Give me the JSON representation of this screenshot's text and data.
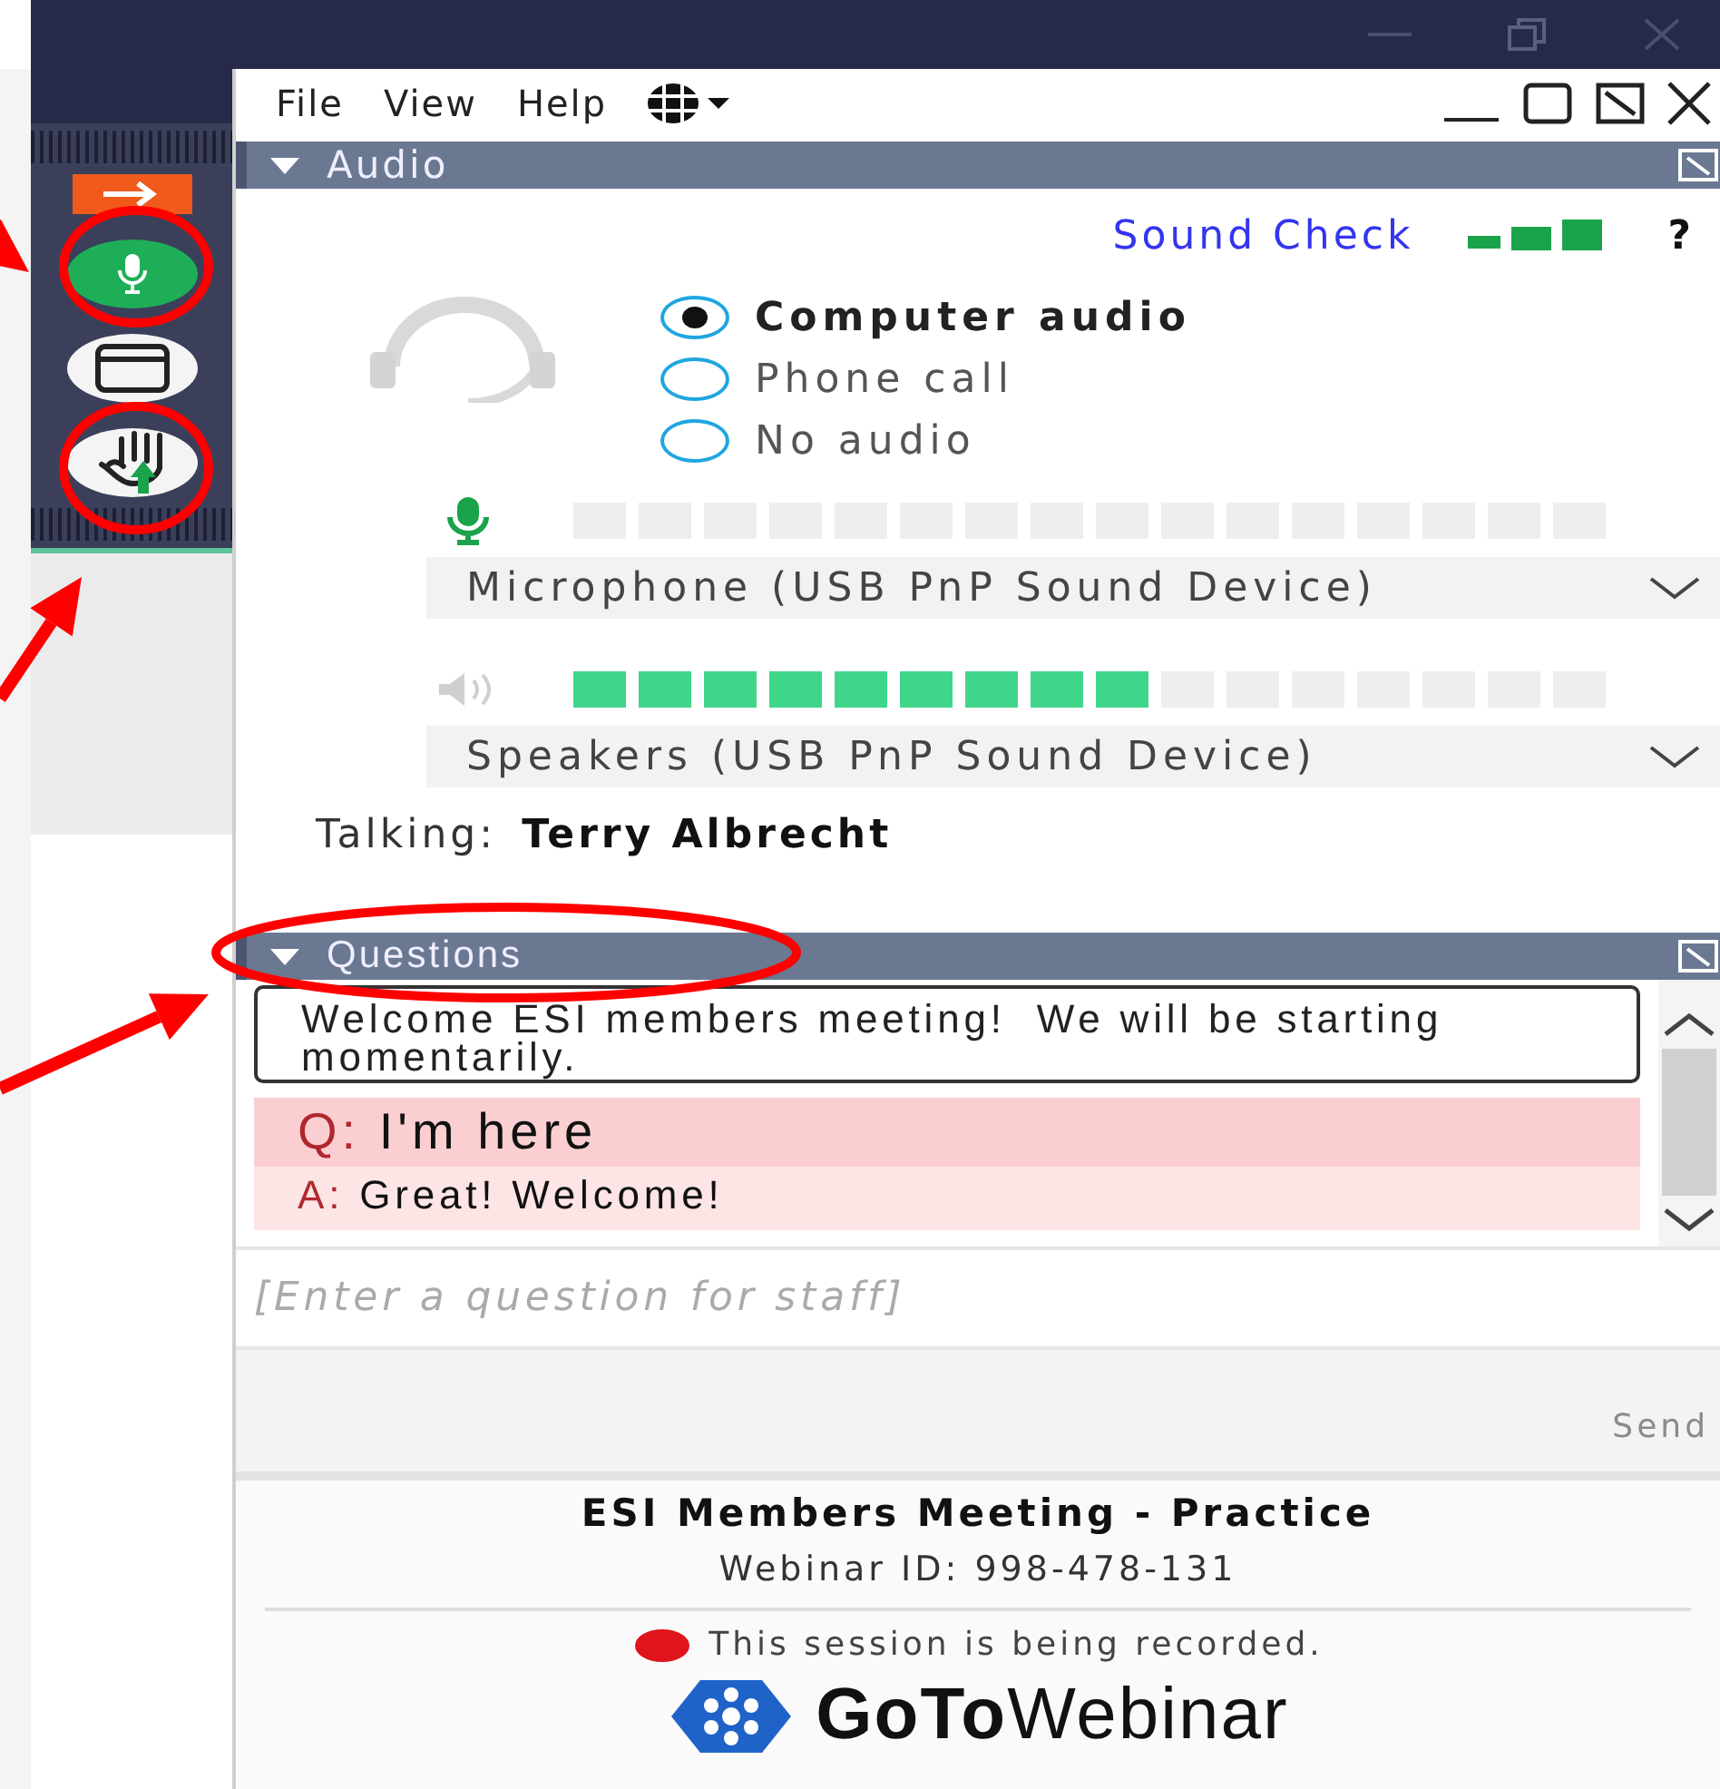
{
  "toolbar": [
    {
      "kind": "arrow"
    },
    {
      "kind": "microphone",
      "on": true
    },
    {
      "kind": "window"
    },
    {
      "kind": "hand"
    }
  ],
  "menu": [
    "File",
    "View",
    "Help"
  ],
  "audio": {
    "title": "Audio",
    "sound_check": "Sound Check",
    "help": "?",
    "mode_options": [
      {
        "label": "Computer audio",
        "selected": true
      },
      {
        "label": "Phone call",
        "selected": false
      },
      {
        "label": "No audio",
        "selected": false
      }
    ],
    "microphone": {
      "level": 0,
      "device": "Microphone (USB PnP Sound Device)"
    },
    "speakers": {
      "level": 0.5625,
      "device": "Speakers (USB PnP Sound Device)"
    },
    "talking_label": "Talking:",
    "talking_name": "Terry Albrecht"
  },
  "questions": {
    "title": "Questions",
    "messages": [
      {
        "kind": "announcement",
        "text": "Welcome ESI members meeting!  We will be starting momentarily."
      },
      {
        "kind": "qa",
        "q_label": "Q:",
        "question": "I'm here",
        "a_label": "A:",
        "answer": "Great! Welcome!"
      }
    ],
    "input": {
      "placeholder": "[Enter a question for staff]"
    },
    "send": {
      "label": "Send",
      "disabled": true
    }
  },
  "footer": {
    "title": "ESI Members Meeting - Practice",
    "webinar_id": "Webinar ID: 998-478-131",
    "recording": "This session is being recorded.",
    "logo": "**GoTo**Webinar"
  }
}
